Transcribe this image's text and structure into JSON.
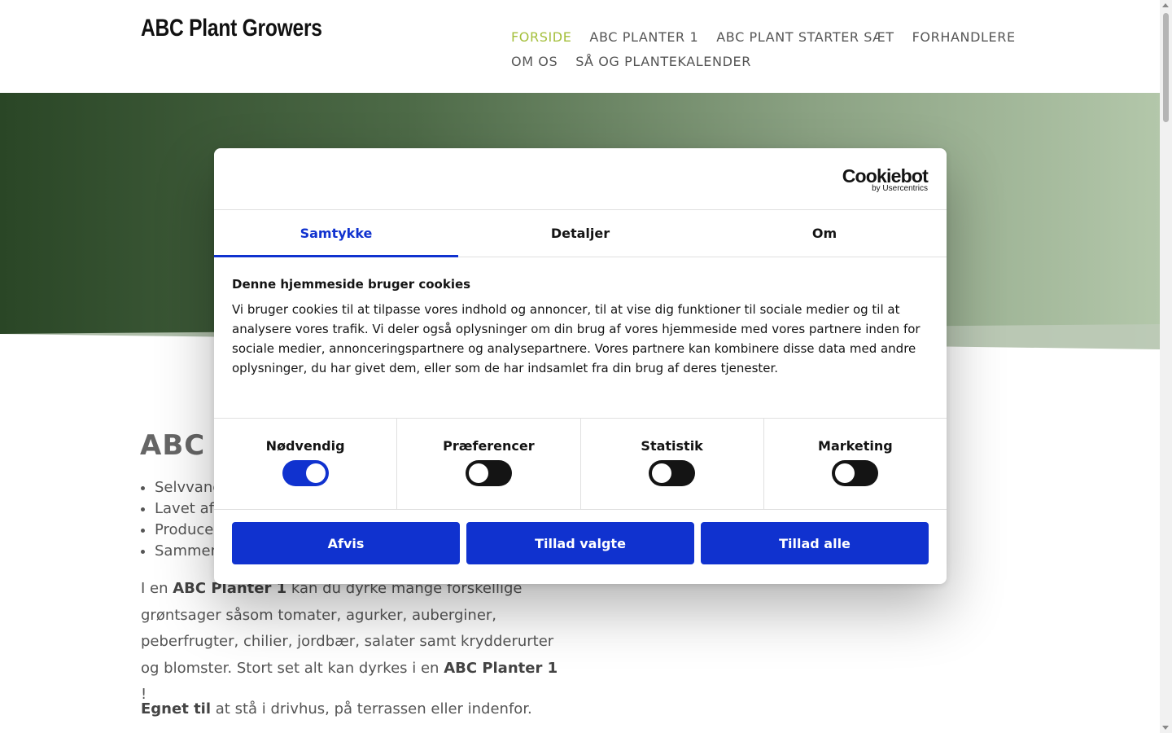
{
  "header": {
    "logo": "ABC Plant Growers",
    "nav_row1": [
      {
        "label": "FORSIDE",
        "active": true
      },
      {
        "label": "ABC PLANTER 1"
      },
      {
        "label": "ABC PLANT STARTER SÆT"
      },
      {
        "label": "FORHANDLERE"
      }
    ],
    "nav_row2": [
      {
        "label": "OM OS"
      },
      {
        "label": "SÅ OG PLANTEKALENDER"
      }
    ]
  },
  "content": {
    "title": "ABC P",
    "bullets": [
      "Selvvanc",
      "Lavet af",
      "Producer",
      "Sammen"
    ],
    "para1": {
      "t1": "I en ",
      "b1": "ABC Planter 1",
      "t2": " kan du dyrke mange forskellige grøntsager såsom tomater, agurker, auberginer, peberfrugter, chilier, jordbær, salater samt krydderurter og blomster. Stort set alt kan dyrkes i en ",
      "b2": "ABC Planter 1",
      "t3": " !"
    },
    "para2": {
      "b1": "Egnet til",
      "t1": " at stå i drivhus, på terrassen eller indenfor."
    }
  },
  "cookie_dialog": {
    "brand": "Cookiebot",
    "brand_sub": "by Usercentrics",
    "tabs": [
      "Samtykke",
      "Detaljer",
      "Om"
    ],
    "active_tab": "Samtykke",
    "title": "Denne hjemmeside bruger cookies",
    "text": "Vi bruger cookies til at tilpasse vores indhold og annoncer, til at vise dig funktioner til sociale medier og til at analysere vores trafik. Vi deler også oplysninger om din brug af vores hjemmeside med vores partnere inden for sociale medier, annonceringspartnere og analysepartnere. Vores partnere kan kombinere disse data med andre oplysninger, du har givet dem, eller som de har indsamlet fra din brug af deres tjenester.",
    "toggles": [
      {
        "label": "Nødvendig",
        "on": true
      },
      {
        "label": "Præferencer",
        "on": false
      },
      {
        "label": "Statistik",
        "on": false
      },
      {
        "label": "Marketing",
        "on": false
      }
    ],
    "buttons": {
      "reject": "Afvis",
      "allow_selected": "Tillad valgte",
      "allow_all": "Tillad alle"
    }
  },
  "colors": {
    "accent_nav": "#a4bf3b",
    "dialog_blue": "#1032cf",
    "hero_dark": "#2d4a28",
    "hero_light": "#b0c4a8"
  }
}
